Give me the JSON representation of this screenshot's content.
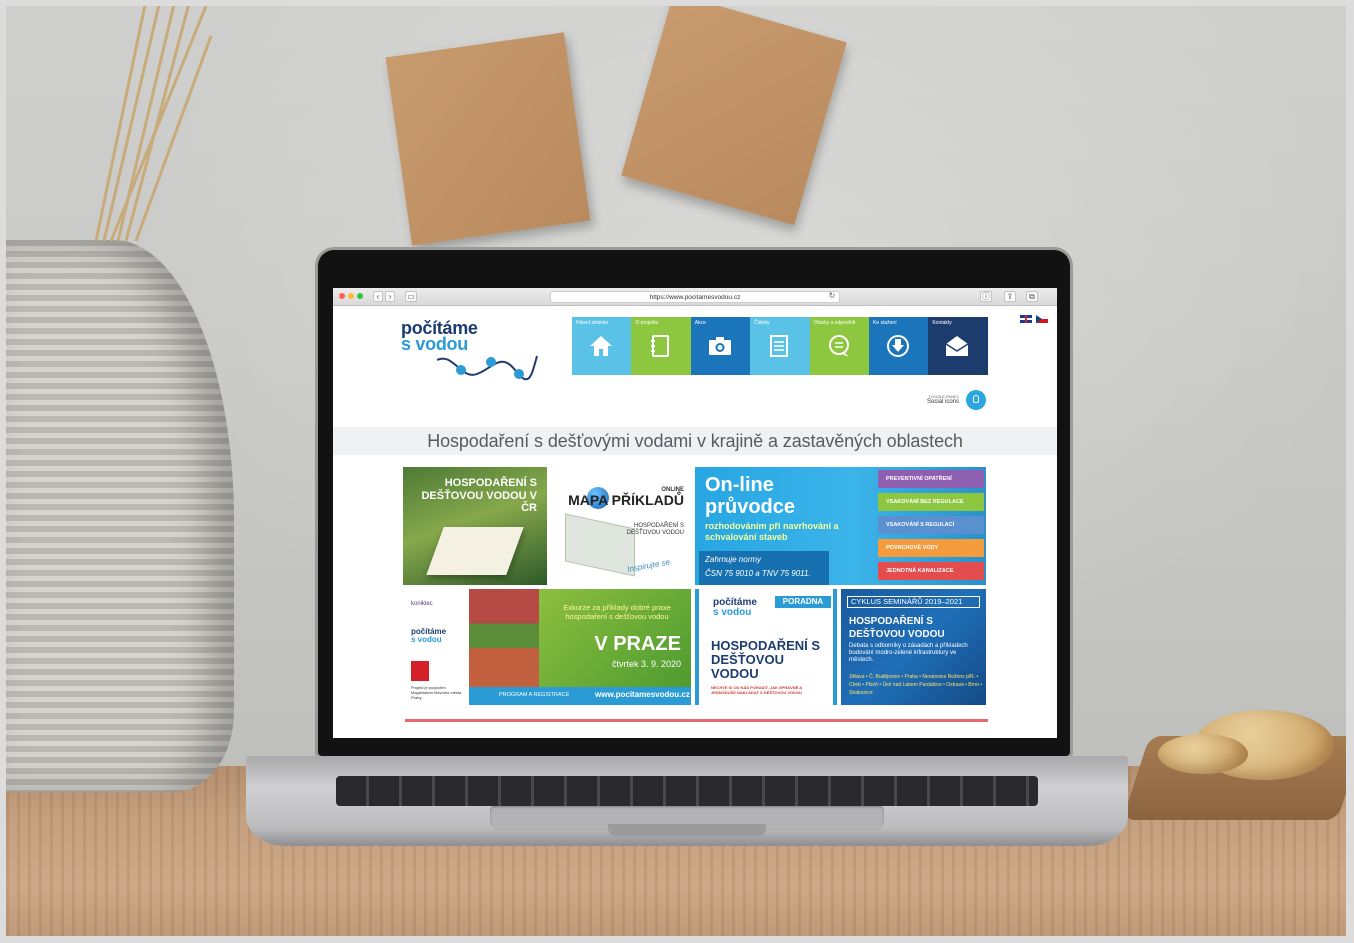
{
  "browser": {
    "url": "https://www.pocitamesvodou.cz"
  },
  "site": {
    "logo": {
      "line1": "počítáme",
      "line2": "s vodou"
    },
    "nav": [
      {
        "label": "Hlavní stránka",
        "color": "#5bc2e7",
        "icon": "home-icon"
      },
      {
        "label": "O projektu",
        "color": "#8dc63f",
        "icon": "notebook-icon"
      },
      {
        "label": "Akce",
        "color": "#1b75bb",
        "icon": "camera-icon"
      },
      {
        "label": "Články",
        "color": "#5bc2e7",
        "icon": "document-icon"
      },
      {
        "label": "Otázky a odpovědi",
        "color": "#8dc63f",
        "icon": "chat-icon"
      },
      {
        "label": "Ke stažení",
        "color": "#1b75bb",
        "icon": "download-icon"
      },
      {
        "label": "Kontakty",
        "color": "#1d3c6e",
        "icon": "mail-icon"
      }
    ],
    "toggle_panel": {
      "top": "TOGGLE PANEL",
      "sub": "Social icons"
    },
    "headline": "Hospodaření s dešťovými vodami v krajině a zastavěných oblastech"
  },
  "banners": {
    "hospodareni": {
      "title": "HOSPODAŘENÍ S DEŠŤOVOU VODOU V ČR"
    },
    "mapa": {
      "kicker": "ONLINE",
      "title": "MAPA PŘÍKLADŮ",
      "sub": "HOSPODAŘENÍ S DEŠŤOVOU VODOU",
      "tagline": "Inspirujte se."
    },
    "online": {
      "title1": "On-line",
      "title2": "průvodce",
      "sub": "rozhodováním při navrhování a schvalování staveb",
      "normy1": "Zahrnuje normy",
      "normy2": "ČSN 75 9010 a TNV 75 9011.",
      "categories": [
        {
          "label": "PREVENTIVNÍ OPATŘENÍ",
          "color": "#8e5fb0"
        },
        {
          "label": "VSAKOVÁNÍ BEZ REGULACE",
          "color": "#8dc63f"
        },
        {
          "label": "VSAKOVÁNÍ S REGULACÍ",
          "color": "#5a8fd0"
        },
        {
          "label": "POVRCHOVÉ VODY",
          "color": "#f49b3d"
        },
        {
          "label": "JEDNOTNÁ KANALIZACE",
          "color": "#e34d4d"
        }
      ]
    },
    "exkurze": {
      "koniklec": "koniklec",
      "logo1": "počítáme",
      "logo2": "s vodou",
      "support": "Projekt je podpořen Magistrátem hlavního města Prahy.",
      "line": "Exkurze za příklady dobré praxe hospodaření s dešťovou vodou",
      "city": "V PRAZE",
      "date": "čtvrtek 3. 9. 2020",
      "footer_label": "PROGRAM A REGISTRACE",
      "footer_url": "www.pocitamesvodou.cz"
    },
    "poradna": {
      "logo1": "počítáme",
      "logo2": "s vodou",
      "badge": "PORADNA",
      "title": "HOSPODAŘENÍ S DEŠŤOVOU VODOU",
      "sub": "NECHTE SI OD NÁS PORADIT, JAK SPRÁVNĚ A JEDNODUŠE NAKLÁDAT S DEŠŤOVOU VODOU"
    },
    "cyklus": {
      "header": "CYKLUS SEMINÁŘŮ 2019–2021",
      "title": "HOSPODAŘENÍ S DEŠŤOVOU VODOU",
      "sub": "Debata s odborníky o zásadách a příkladech budování modro-zelené infrastruktury ve městech.",
      "cities": "Jihlava • Č. Budějovice • Praha • Neratovice Rožnov p/R. • Cheb • Plzeň • Ústí nad Labem Pardubice • Ostrava • Brno • Strakonice"
    }
  }
}
